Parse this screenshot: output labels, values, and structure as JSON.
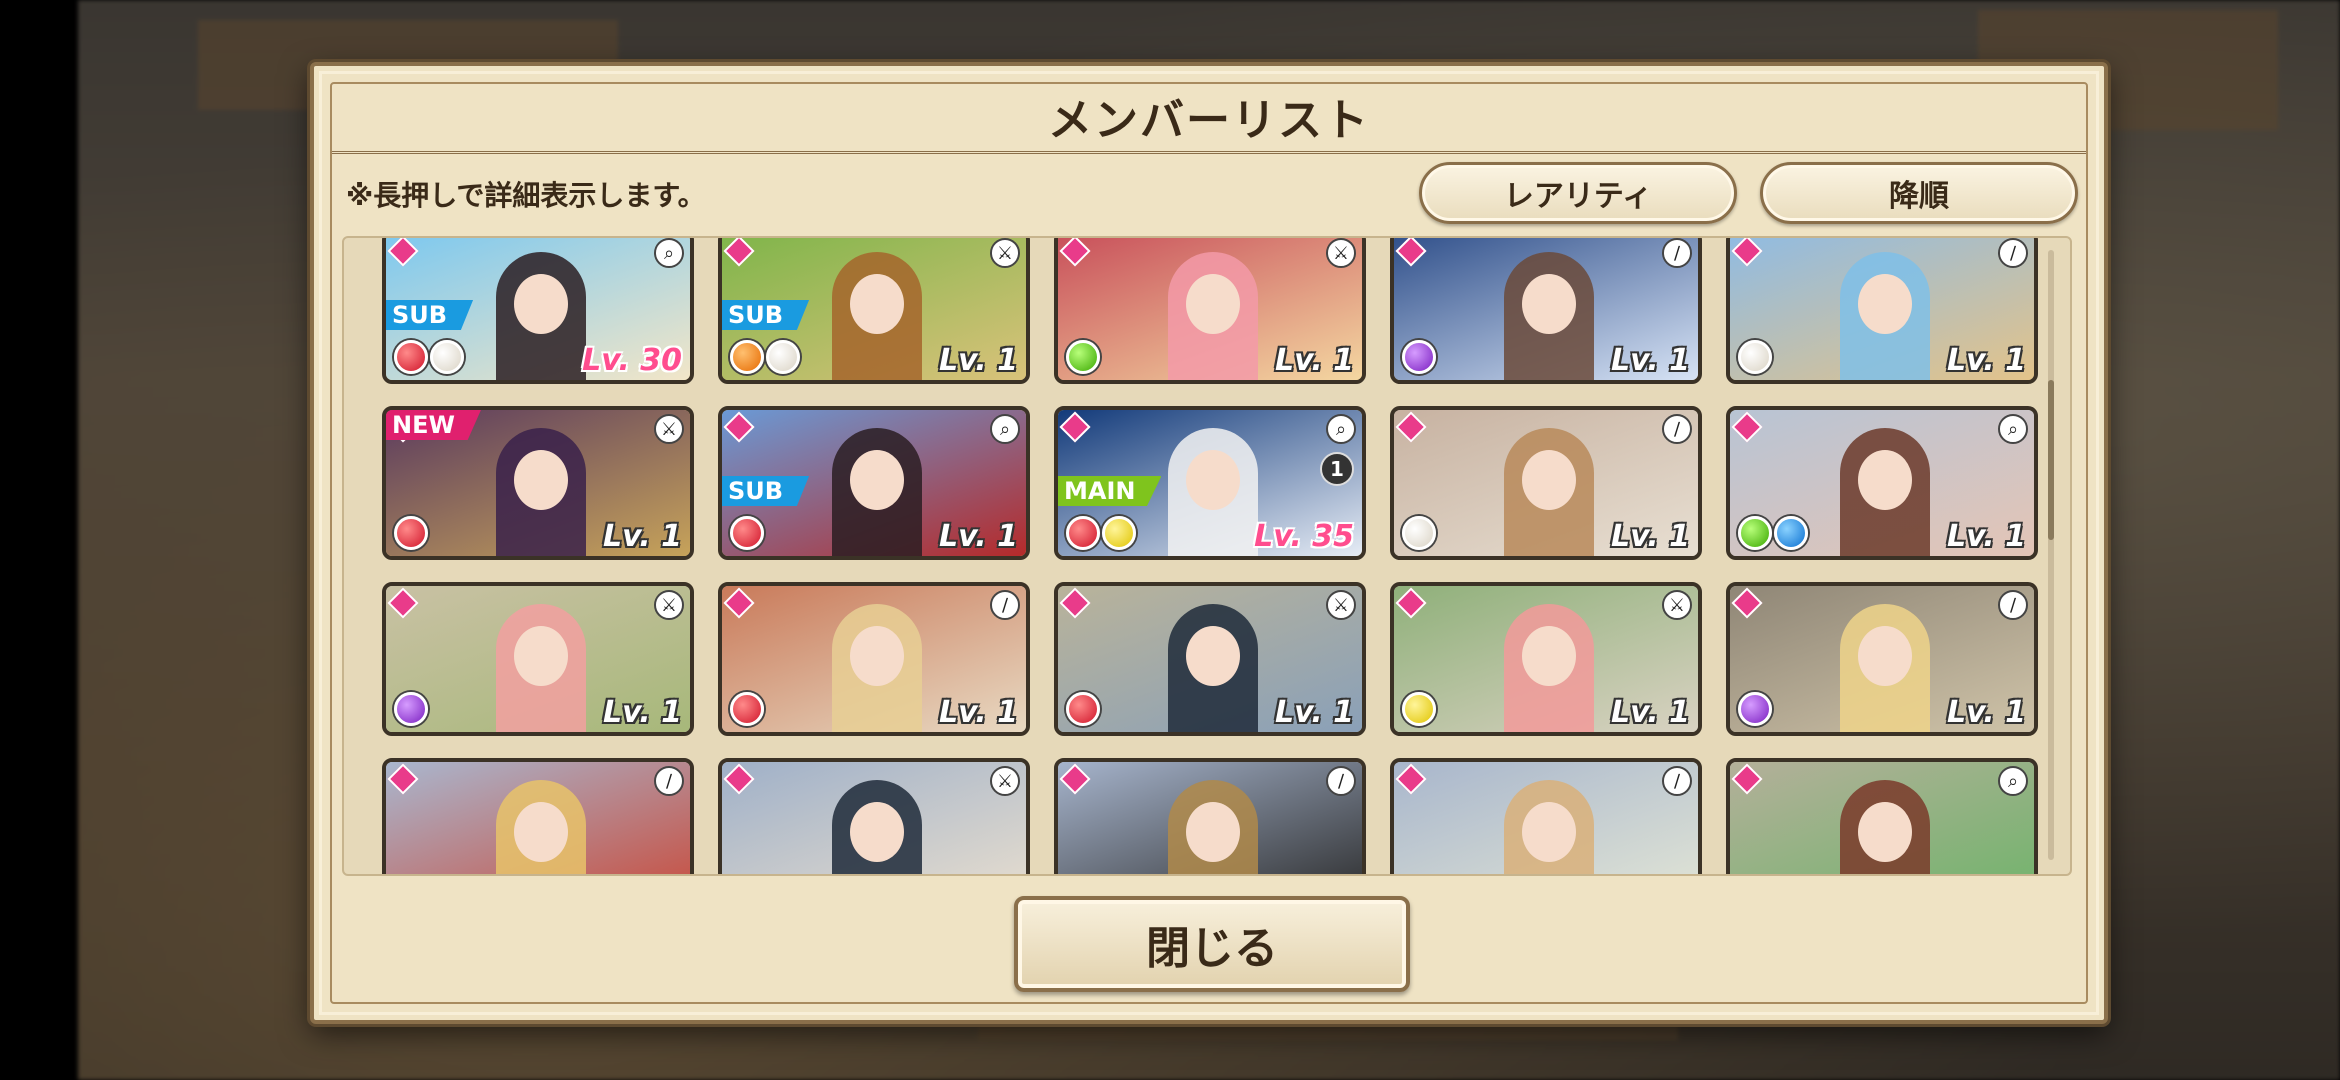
{
  "dialog": {
    "title": "メンバーリスト",
    "hint": "※長押しで詳細表示します。",
    "sort_rarity_label": "レアリティ",
    "sort_order_label": "降順",
    "close_label": "閉じる"
  },
  "cards": [
    {
      "tag": "SUB",
      "tag_type": "sub",
      "level": "Lv. 30",
      "level_style": "pink",
      "orbs": [
        "red",
        "white"
      ],
      "tool": "search-icon",
      "frame": "gold",
      "art": [
        "#7cc8ef",
        "#f2e6c8"
      ],
      "hair": "#2a1d22"
    },
    {
      "tag": "SUB",
      "tag_type": "sub",
      "level": "Lv. 1",
      "level_style": "normal",
      "orbs": [
        "orange",
        "white"
      ],
      "tool": "sword-icon",
      "frame": "gold",
      "art": [
        "#7fb54a",
        "#d9c27a"
      ],
      "hair": "#a5652b"
    },
    {
      "tag": "",
      "tag_type": "",
      "level": "Lv. 1",
      "level_style": "normal",
      "orbs": [
        "green"
      ],
      "tool": "sword-icon",
      "frame": "gold",
      "art": [
        "#c84f5a",
        "#f4d7a1"
      ],
      "hair": "#f39aa8"
    },
    {
      "tag": "",
      "tag_type": "",
      "level": "Lv. 1",
      "level_style": "normal",
      "orbs": [
        "purple"
      ],
      "tool": "staff-icon",
      "frame": "gold",
      "art": [
        "#2f4f8a",
        "#d7e3f5"
      ],
      "hair": "#6b4a3a"
    },
    {
      "tag": "",
      "tag_type": "",
      "level": "Lv. 1",
      "level_style": "normal",
      "orbs": [
        "white"
      ],
      "tool": "staff-icon",
      "frame": "gold",
      "art": [
        "#8fbbe3",
        "#e3c38a"
      ],
      "hair": "#7fc0e8"
    },
    {
      "tag": "NEW",
      "tag_type": "new",
      "level": "Lv. 1",
      "level_style": "normal",
      "orbs": [
        "red"
      ],
      "tool": "sword-icon",
      "frame": "gold",
      "art": [
        "#5a3a5e",
        "#c7a35a"
      ],
      "hair": "#3a214a"
    },
    {
      "tag": "SUB",
      "tag_type": "sub",
      "level": "Lv. 1",
      "level_style": "normal",
      "orbs": [
        "red"
      ],
      "tool": "search-icon",
      "frame": "gold",
      "art": [
        "#6a9ad6",
        "#b52a2a"
      ],
      "hair": "#2a1d22"
    },
    {
      "tag": "MAIN",
      "tag_type": "main",
      "level": "Lv. 35",
      "level_style": "pink",
      "orbs": [
        "red",
        "yellow"
      ],
      "tool": "search-icon",
      "frame": "gold",
      "badge": "1",
      "art": [
        "#123a7a",
        "#e6ecf5"
      ],
      "hair": "#f2f2f2"
    },
    {
      "tag": "",
      "tag_type": "",
      "level": "Lv. 1",
      "level_style": "normal",
      "orbs": [
        "white"
      ],
      "tool": "staff-icon",
      "frame": "silver",
      "art": [
        "#c7b2a1",
        "#e8dfd2"
      ],
      "hair": "#b8895a"
    },
    {
      "tag": "",
      "tag_type": "",
      "level": "Lv. 1",
      "level_style": "normal",
      "orbs": [
        "green",
        "blue"
      ],
      "tool": "search-icon",
      "frame": "silver",
      "art": [
        "#b8c4d4",
        "#e4c5b6"
      ],
      "hair": "#6b3a2a"
    },
    {
      "tag": "",
      "tag_type": "",
      "level": "Lv. 1",
      "level_style": "normal",
      "orbs": [
        "purple"
      ],
      "tool": "sword-icon",
      "frame": "silver",
      "art": [
        "#c9c1a4",
        "#a7b87a"
      ],
      "hair": "#f2a0a0"
    },
    {
      "tag": "",
      "tag_type": "",
      "level": "Lv. 1",
      "level_style": "normal",
      "orbs": [
        "red"
      ],
      "tool": "staff-icon",
      "frame": "silver",
      "art": [
        "#c97a5a",
        "#e8d9c2"
      ],
      "hair": "#e8cf94"
    },
    {
      "tag": "",
      "tag_type": "",
      "level": "Lv. 1",
      "level_style": "normal",
      "orbs": [
        "red"
      ],
      "tool": "sword-icon",
      "frame": "silver",
      "art": [
        "#b9b39a",
        "#8aa0b8"
      ],
      "hair": "#1f2a3a"
    },
    {
      "tag": "",
      "tag_type": "",
      "level": "Lv. 1",
      "level_style": "normal",
      "orbs": [
        "yellow"
      ],
      "tool": "sword-icon",
      "frame": "silver",
      "art": [
        "#8fb07a",
        "#d9d2c2"
      ],
      "hair": "#f29a9a"
    },
    {
      "tag": "",
      "tag_type": "",
      "level": "Lv. 1",
      "level_style": "normal",
      "orbs": [
        "purple"
      ],
      "tool": "staff-icon",
      "frame": "silver",
      "art": [
        "#8f8676",
        "#cfc3a8"
      ],
      "hair": "#eed48a"
    },
    {
      "tag": "",
      "tag_type": "",
      "level": "",
      "level_style": "normal",
      "orbs": [],
      "tool": "staff-icon",
      "frame": "silver",
      "art": [
        "#a9b7cf",
        "#c94a3a"
      ],
      "hair": "#e8c36a"
    },
    {
      "tag": "",
      "tag_type": "",
      "level": "",
      "level_style": "normal",
      "orbs": [],
      "tool": "sword-icon",
      "frame": "silver",
      "art": [
        "#9fb0c8",
        "#e9dfcf"
      ],
      "hair": "#1f2a3a"
    },
    {
      "tag": "",
      "tag_type": "",
      "level": "",
      "level_style": "normal",
      "orbs": [],
      "tool": "staff-icon",
      "frame": "silver",
      "art": [
        "#a6b4cc",
        "#2a2a2a"
      ],
      "hair": "#b08a4a"
    },
    {
      "tag": "",
      "tag_type": "",
      "level": "",
      "level_style": "normal",
      "orbs": [],
      "tool": "staff-icon",
      "frame": "silver",
      "art": [
        "#a8b6cc",
        "#e3e6d6"
      ],
      "hair": "#d9b07a"
    },
    {
      "tag": "",
      "tag_type": "",
      "level": "",
      "level_style": "normal",
      "orbs": [],
      "tool": "search-icon",
      "frame": "silver",
      "art": [
        "#b4b09a",
        "#6fb46a"
      ],
      "hair": "#7a3a2a"
    }
  ]
}
